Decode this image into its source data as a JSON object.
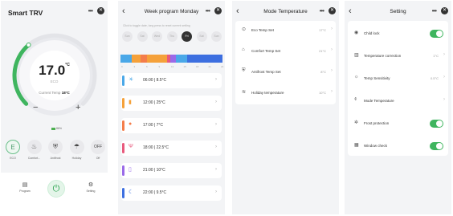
{
  "home": {
    "title": "Smart TRV",
    "setpoint": "17.0",
    "unit": "°C",
    "mode_label": "ECO",
    "current_label": "Current Temp",
    "current_value": "18°C",
    "minus": "−",
    "plus": "+",
    "battery": "86%",
    "modes": [
      {
        "icon": "E",
        "label": "ECO",
        "active": true
      },
      {
        "icon": "♨",
        "label": "Comfort..."
      },
      {
        "icon": "⛨",
        "label": "Antifrost"
      },
      {
        "icon": "☂",
        "label": "Holiday"
      },
      {
        "icon": "OFF",
        "label": "Off"
      }
    ],
    "nav": {
      "program": "Program",
      "setting": "Setting"
    },
    "setpoint_fraction": 0.35,
    "colors": {
      "accent": "#3fb55f"
    }
  },
  "week": {
    "title": "Week program Monday",
    "hint": "Click to toggle date, long press to reset current setting",
    "days": [
      "Sun",
      "Sat",
      "Wed",
      "Thu",
      "Fri",
      "Sat",
      "Sun"
    ],
    "active_day": 4,
    "ticks": [
      "0",
      "3",
      "6",
      "9",
      "12",
      "15",
      "18",
      "21",
      "24"
    ],
    "slots": [
      {
        "text": "06:00  |  8.5°C",
        "icon": "☀",
        "color": "#4aa8e8"
      },
      {
        "text": "12:00  |  25°C",
        "icon": "▮",
        "color": "#f5a13a"
      },
      {
        "text": "17:00  |  7°C",
        "icon": "●",
        "color": "#f47d4a"
      },
      {
        "text": "18:00  |  22.5°C",
        "icon": "Ψ",
        "color": "#e85a7d"
      },
      {
        "text": "21:00  |  10°C",
        "icon": "▯",
        "color": "#9a6ae8"
      },
      {
        "text": "22:00  |  9.5°C",
        "icon": "☾",
        "color": "#3d6fe0"
      }
    ]
  },
  "mode_temp": {
    "title": "Mode Temperature",
    "rows": [
      {
        "label": "Eco Temp Set",
        "value": "17°C",
        "icon": "⊙"
      },
      {
        "label": "Comfort Temp Set",
        "value": "21°C",
        "icon": "⌂"
      },
      {
        "label": "Antifrost Temp Set",
        "value": "8°C",
        "icon": "⛨"
      },
      {
        "label": "Holiday temperature",
        "value": "10°C",
        "icon": "≋"
      }
    ]
  },
  "setting": {
    "title": "Setting",
    "rows": [
      {
        "label": "Child lock",
        "icon": "◉",
        "toggle": true
      },
      {
        "label": "Temperature correction",
        "icon": "▥",
        "value": "1°C"
      },
      {
        "label": "Temp Sensitivity",
        "icon": "☼",
        "value": "0.5°C"
      },
      {
        "label": "Mode Temperature",
        "icon": "⌽"
      },
      {
        "label": "Frost protection",
        "icon": "✲",
        "toggle": true
      },
      {
        "label": "Window check",
        "icon": "▦",
        "toggle": true
      }
    ]
  }
}
